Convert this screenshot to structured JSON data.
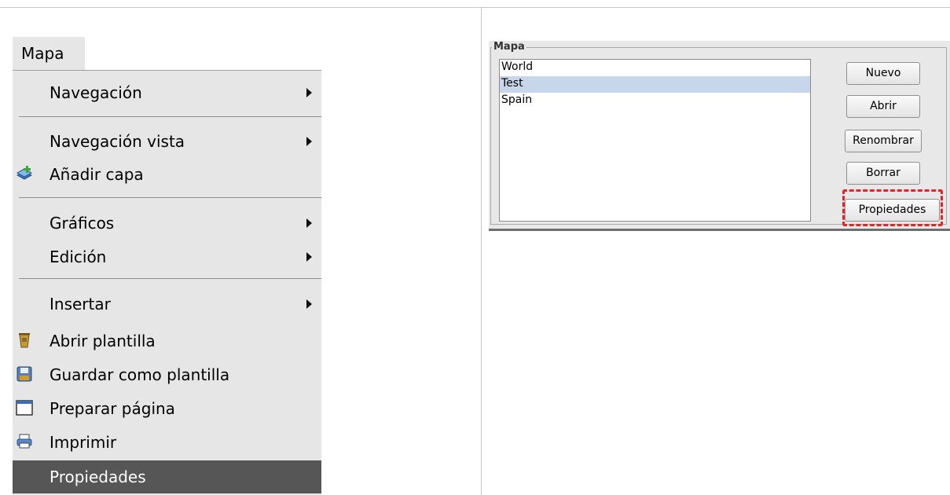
{
  "menu": {
    "title": "Mapa",
    "items": [
      {
        "label": "Navegación",
        "submenu": true,
        "icon": null
      },
      {
        "label": "Navegación vista",
        "submenu": true,
        "icon": null
      },
      {
        "label": "Añadir capa",
        "submenu": false,
        "icon": "add-layer-icon"
      },
      {
        "label": "Gráficos",
        "submenu": true,
        "icon": null
      },
      {
        "label": "Edición",
        "submenu": true,
        "icon": null
      },
      {
        "label": "Insertar",
        "submenu": true,
        "icon": null
      },
      {
        "label": "Abrir plantilla",
        "submenu": false,
        "icon": "open-template-icon"
      },
      {
        "label": "Guardar como plantilla",
        "submenu": false,
        "icon": "save-template-icon"
      },
      {
        "label": "Preparar página",
        "submenu": false,
        "icon": "page-setup-icon"
      },
      {
        "label": "Imprimir",
        "submenu": false,
        "icon": "printer-icon"
      },
      {
        "label": "Propiedades",
        "submenu": false,
        "icon": null,
        "active": true
      }
    ]
  },
  "map_group": {
    "legend": "Mapa",
    "maps": [
      "World",
      "Test",
      "Spain"
    ],
    "selected": "Test",
    "buttons": {
      "new": "Nuevo",
      "open": "Abrir",
      "rename": "Renombrar",
      "delete": "Borrar",
      "properties": "Propiedades"
    }
  },
  "colors": {
    "menu_bg": "#e6e6e6",
    "menu_active": "#565656",
    "list_selection": "#c7d6ea",
    "highlight": "#e0262d"
  }
}
